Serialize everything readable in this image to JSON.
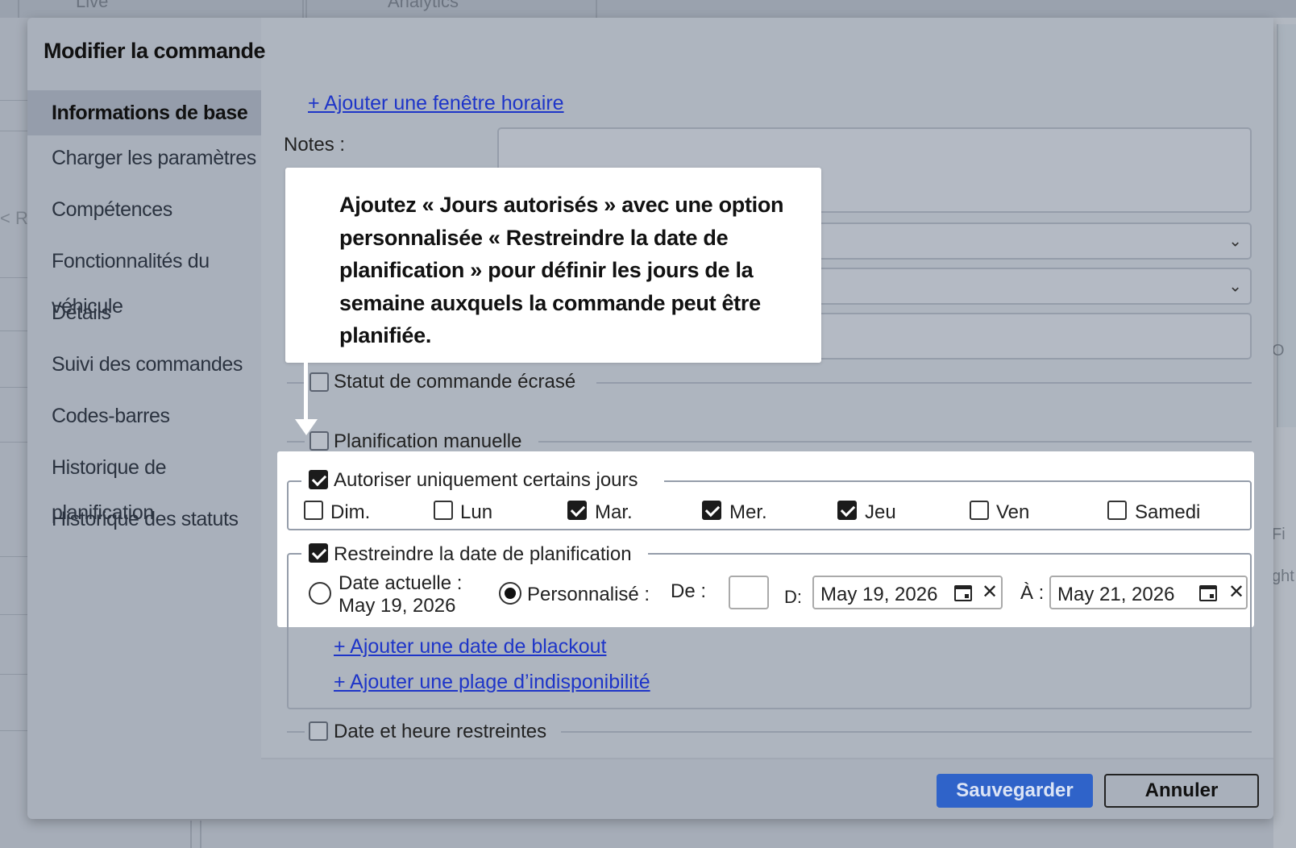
{
  "background": {
    "tabs": [
      "Live",
      "Analytics"
    ],
    "left_fragment": "< Re",
    "right_fragments": [
      "O",
      "Fi",
      "ght"
    ]
  },
  "modal": {
    "title": "Modifier la commande"
  },
  "sidebar": {
    "items": [
      {
        "label": "Informations de base",
        "active": true
      },
      {
        "label": "Charger les paramètres"
      },
      {
        "label": "Compétences"
      },
      {
        "label": "Fonctionnalités du véhicule"
      },
      {
        "label": "Détails"
      },
      {
        "label": "Suivi des commandes"
      },
      {
        "label": "Codes-barres"
      },
      {
        "label": "Historique de planification"
      },
      {
        "label": "Historique des statuts"
      }
    ]
  },
  "form": {
    "add_time_window": "+ Ajouter une fenêtre horaire",
    "notes_label": "Notes :",
    "status_override": "Statut de commande écrasé",
    "manual_planning": "Planification manuelle",
    "allowed_days": {
      "label": "Autoriser uniquement certains jours",
      "checked": true,
      "days": [
        {
          "label": "Dim.",
          "checked": false
        },
        {
          "label": "Lun",
          "checked": false
        },
        {
          "label": "Mar.",
          "checked": true
        },
        {
          "label": "Mer.",
          "checked": true
        },
        {
          "label": "Jeu",
          "checked": true
        },
        {
          "label": "Ven",
          "checked": false
        },
        {
          "label": "Samedi",
          "checked": false
        }
      ]
    },
    "restrict_date": {
      "label": "Restreindre la date de planification",
      "checked": true,
      "current_date_label_1": "Date actuelle :",
      "current_date_label_2": "May 19, 2026",
      "custom_label": "Personnalisé :",
      "from_label": "De :",
      "d_label": "D:",
      "from_value": "May 19, 2026",
      "to_label": "À :",
      "to_value": "May 21, 2026"
    },
    "add_blackout": "+ Ajouter une date de blackout",
    "add_unavailability": "+ Ajouter une plage d’indisponibilité",
    "restricted_datetime": "Date et heure restreintes"
  },
  "tooltip": {
    "text": "Ajoutez « Jours autorisés » avec une option personnalisée « Restreindre la date de planification » pour définir les jours de la semaine auxquels la commande peut être planifiée."
  },
  "buttons": {
    "save": "Sauvegarder",
    "cancel": "Annuler"
  },
  "colors": {
    "save_button": "#2f63c9",
    "link": "#1e35c8",
    "overlay": "#a9b0bb"
  }
}
